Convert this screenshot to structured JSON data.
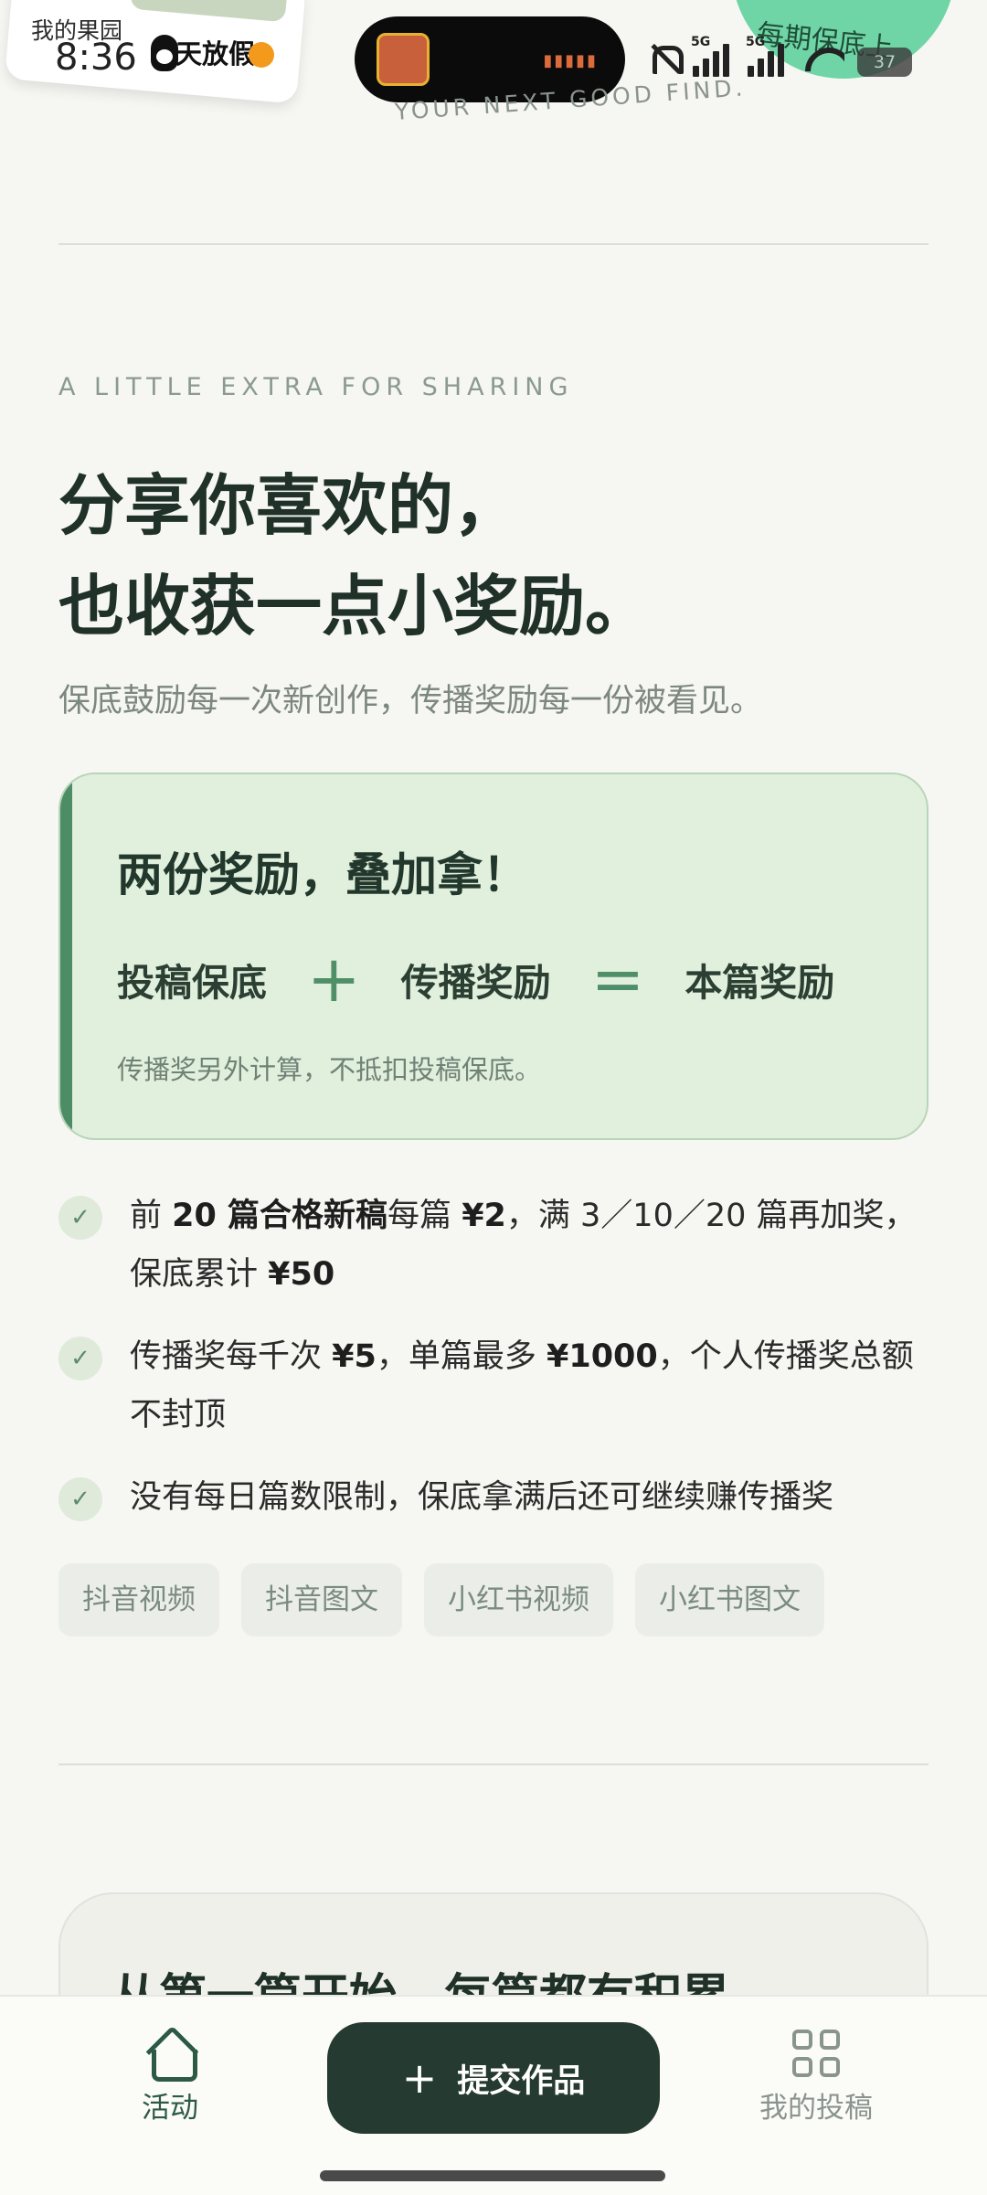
{
  "status_bar": {
    "time": "8:36",
    "sticker_label": "我的果园",
    "notification_text": "天放假",
    "tagline": "YOUR NEXT GOOD FIND.",
    "badge_text": "每期保底上",
    "battery": "37",
    "network": "5G"
  },
  "hero": {
    "eyebrow": "A LITTLE EXTRA FOR SHARING",
    "headline_line1": "分享你喜欢的，",
    "headline_line2": "也收获一点小奖励。",
    "subtitle": "保底鼓励每一次新创作，传播奖励每一份被看见。"
  },
  "reward_card": {
    "title": "两份奖励，叠加拿！",
    "term1": "投稿保底",
    "op_plus": "+",
    "term2": "传播奖励",
    "op_equals": "=",
    "result": "本篇奖励",
    "note": "传播奖另外计算，不抵扣投稿保底。"
  },
  "bullets": [
    {
      "check": "✓",
      "p1": "前 ",
      "b1": "20 篇合格新稿",
      "p2": "每篇 ",
      "b2": "¥2",
      "p3": "，满 3／10／20 篇再加奖，保底累计 ",
      "b3": "¥50"
    },
    {
      "check": "✓",
      "p1": "传播奖每千次 ",
      "b1": "¥5",
      "p2": "，单篇最多 ",
      "b2": "¥1000",
      "p3": "，个人传播奖总额不封顶"
    },
    {
      "check": "✓",
      "p1": "没有每日篇数限制，保底拿满后还可继续赚传播奖"
    }
  ],
  "platform_tags": [
    "抖音视频",
    "抖音图文",
    "小红书视频",
    "小红书图文"
  ],
  "next_section": {
    "title": "从第一篇开始，每篇都有积累"
  },
  "bottom_nav": {
    "home_label": "活动",
    "submit_label": "提交作品",
    "submit_icon": "+",
    "mine_label": "我的投稿"
  },
  "colors": {
    "background": "#f6f6f2",
    "primary_dark": "#253a30",
    "accent_green": "#4d8d65",
    "card_green": "#e1efdd",
    "badge_mint": "#6fd5a6"
  }
}
